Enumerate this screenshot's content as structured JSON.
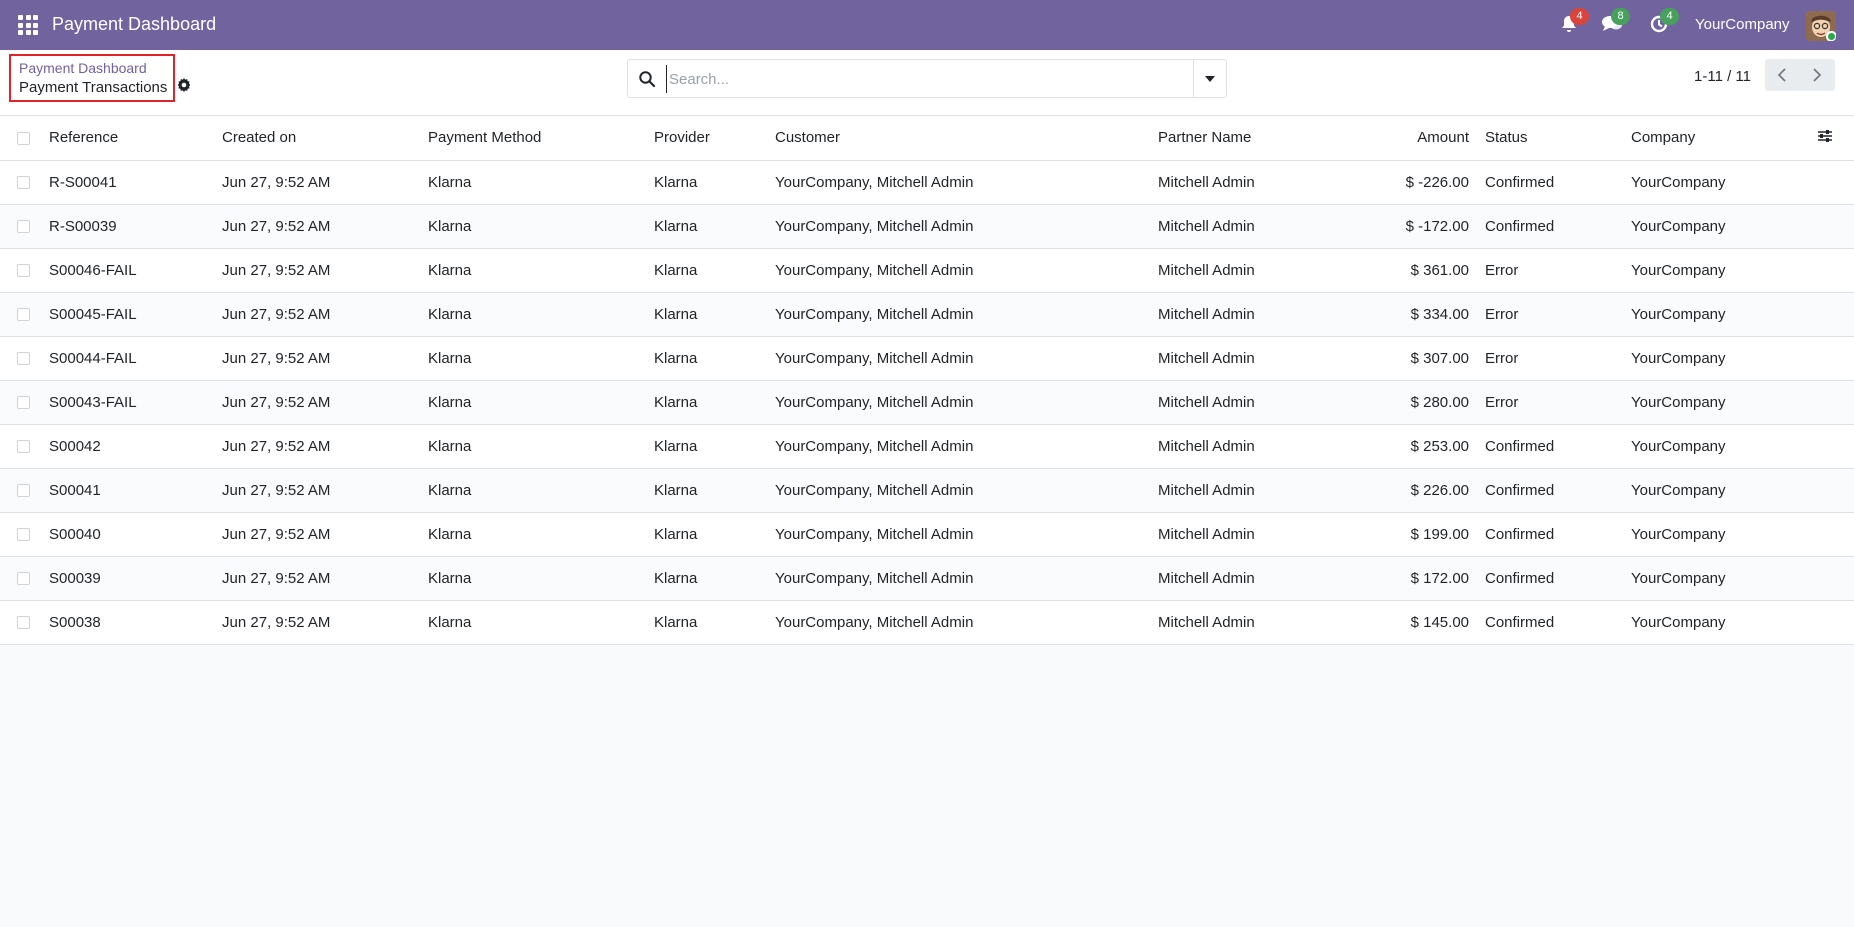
{
  "navbar": {
    "app_title": "Payment Dashboard",
    "notifications": {
      "icon": "bell-icon",
      "count": "4"
    },
    "messages": {
      "icon": "chat-icon",
      "count": "8"
    },
    "activities": {
      "icon": "clock-icon",
      "count": "4"
    },
    "company": "YourCompany",
    "avatar": "user-avatar"
  },
  "breadcrumb": {
    "parent": "Payment Dashboard",
    "current": "Payment Transactions"
  },
  "search": {
    "placeholder": "Search...",
    "value": ""
  },
  "pager": {
    "value": "1-11 / 11"
  },
  "table": {
    "columns": [
      "Reference",
      "Created on",
      "Payment Method",
      "Provider",
      "Customer",
      "Partner Name",
      "Amount",
      "Status",
      "Company"
    ],
    "rows": [
      [
        "R-S00041",
        "Jun 27, 9:52 AM",
        "Klarna",
        "Klarna",
        "YourCompany, Mitchell Admin",
        "Mitchell Admin",
        "$ -226.00",
        "Confirmed",
        "YourCompany"
      ],
      [
        "R-S00039",
        "Jun 27, 9:52 AM",
        "Klarna",
        "Klarna",
        "YourCompany, Mitchell Admin",
        "Mitchell Admin",
        "$ -172.00",
        "Confirmed",
        "YourCompany"
      ],
      [
        "S00046-FAIL",
        "Jun 27, 9:52 AM",
        "Klarna",
        "Klarna",
        "YourCompany, Mitchell Admin",
        "Mitchell Admin",
        "$ 361.00",
        "Error",
        "YourCompany"
      ],
      [
        "S00045-FAIL",
        "Jun 27, 9:52 AM",
        "Klarna",
        "Klarna",
        "YourCompany, Mitchell Admin",
        "Mitchell Admin",
        "$ 334.00",
        "Error",
        "YourCompany"
      ],
      [
        "S00044-FAIL",
        "Jun 27, 9:52 AM",
        "Klarna",
        "Klarna",
        "YourCompany, Mitchell Admin",
        "Mitchell Admin",
        "$ 307.00",
        "Error",
        "YourCompany"
      ],
      [
        "S00043-FAIL",
        "Jun 27, 9:52 AM",
        "Klarna",
        "Klarna",
        "YourCompany, Mitchell Admin",
        "Mitchell Admin",
        "$ 280.00",
        "Error",
        "YourCompany"
      ],
      [
        "S00042",
        "Jun 27, 9:52 AM",
        "Klarna",
        "Klarna",
        "YourCompany, Mitchell Admin",
        "Mitchell Admin",
        "$ 253.00",
        "Confirmed",
        "YourCompany"
      ],
      [
        "S00041",
        "Jun 27, 9:52 AM",
        "Klarna",
        "Klarna",
        "YourCompany, Mitchell Admin",
        "Mitchell Admin",
        "$ 226.00",
        "Confirmed",
        "YourCompany"
      ],
      [
        "S00040",
        "Jun 27, 9:52 AM",
        "Klarna",
        "Klarna",
        "YourCompany, Mitchell Admin",
        "Mitchell Admin",
        "$ 199.00",
        "Confirmed",
        "YourCompany"
      ],
      [
        "S00039",
        "Jun 27, 9:52 AM",
        "Klarna",
        "Klarna",
        "YourCompany, Mitchell Admin",
        "Mitchell Admin",
        "$ 172.00",
        "Confirmed",
        "YourCompany"
      ],
      [
        "S00038",
        "Jun 27, 9:52 AM",
        "Klarna",
        "Klarna",
        "YourCompany, Mitchell Admin",
        "Mitchell Admin",
        "$ 145.00",
        "Confirmed",
        "YourCompany"
      ]
    ]
  },
  "colors": {
    "brand": "#71639e",
    "badge_red": "#d9443b",
    "badge_green": "#47a05c",
    "highlight_border": "#e0242b"
  }
}
